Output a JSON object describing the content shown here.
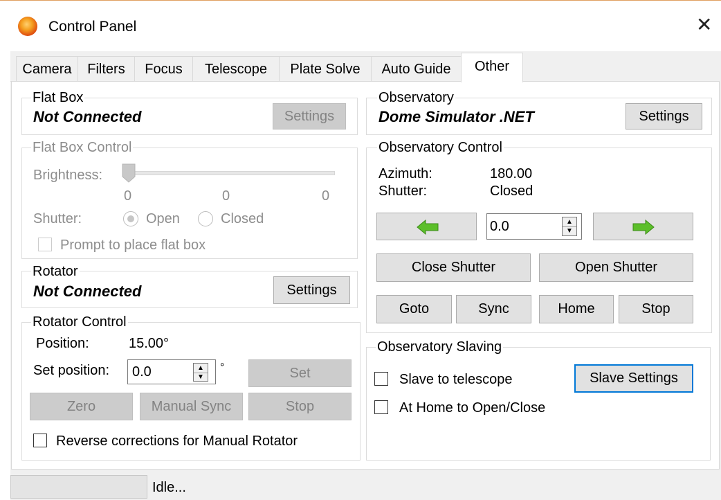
{
  "window": {
    "title": "Control Panel",
    "close_glyph": "✕"
  },
  "tabs": [
    {
      "label": "Camera"
    },
    {
      "label": "Filters"
    },
    {
      "label": "Focus"
    },
    {
      "label": "Telescope"
    },
    {
      "label": "Plate Solve"
    },
    {
      "label": "Auto Guide"
    },
    {
      "label": "Other",
      "active": true
    }
  ],
  "flat_box": {
    "legend": "Flat Box",
    "status": "Not Connected",
    "settings_label": "Settings"
  },
  "flat_box_control": {
    "legend": "Flat Box Control",
    "brightness_label": "Brightness:",
    "slider_min": "0",
    "slider_value": "0",
    "slider_max": "0",
    "shutter_label": "Shutter:",
    "open_label": "Open",
    "closed_label": "Closed",
    "prompt_label": "Prompt to place flat box"
  },
  "rotator": {
    "legend": "Rotator",
    "status": "Not Connected",
    "settings_label": "Settings"
  },
  "rotator_control": {
    "legend": "Rotator Control",
    "position_label": "Position:",
    "position_value": "15.00°",
    "set_position_label": "Set position:",
    "set_position_value": "0.0",
    "degree_unit": "°",
    "set_label": "Set",
    "zero_label": "Zero",
    "manual_sync_label": "Manual Sync",
    "stop_label": "Stop",
    "reverse_label": "Reverse corrections for Manual Rotator"
  },
  "observatory": {
    "legend": "Observatory",
    "name": "Dome Simulator .NET",
    "settings_label": "Settings"
  },
  "observatory_control": {
    "legend": "Observatory Control",
    "azimuth_label": "Azimuth:",
    "azimuth_value": "180.00",
    "shutter_label": "Shutter:",
    "shutter_value": "Closed",
    "step_value": "0.0",
    "close_shutter_label": "Close Shutter",
    "open_shutter_label": "Open Shutter",
    "goto_label": "Goto",
    "sync_label": "Sync",
    "home_label": "Home",
    "stop_label": "Stop"
  },
  "observatory_slaving": {
    "legend": "Observatory Slaving",
    "slave_label": "Slave to telescope",
    "home_open_close_label": "At Home to Open/Close",
    "slave_settings_label": "Slave Settings"
  },
  "status_bar": {
    "text": "Idle..."
  },
  "colors": {
    "accent": "#0078d7",
    "arrow_green": "#5cbf2a"
  }
}
